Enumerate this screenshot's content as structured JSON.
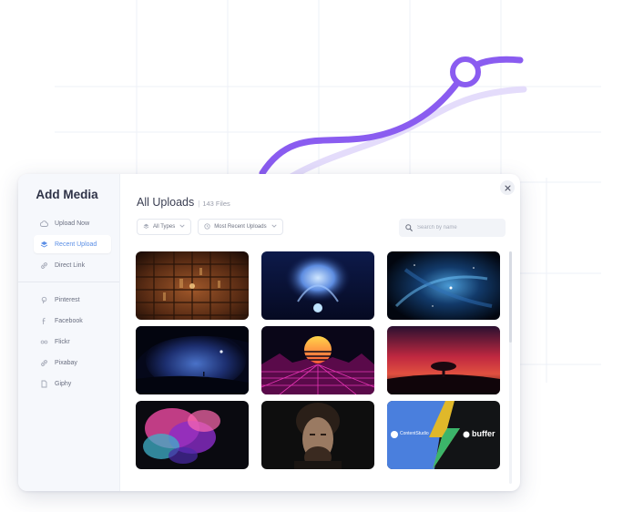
{
  "app": {
    "title": "Add Media",
    "close_icon": "close-icon"
  },
  "sidebar": {
    "items": [
      {
        "label": "Upload Now",
        "icon": "cloud-upload-icon",
        "active": false
      },
      {
        "label": "Recent Upload",
        "icon": "stack-icon",
        "active": true
      },
      {
        "label": "Direct Link",
        "icon": "link-icon",
        "active": false
      }
    ],
    "sources": [
      {
        "label": "Pinterest",
        "icon": "pinterest-icon"
      },
      {
        "label": "Facebook",
        "icon": "facebook-icon"
      },
      {
        "label": "Flickr",
        "icon": "flickr-icon"
      },
      {
        "label": "Pixabay",
        "icon": "pixabay-icon"
      },
      {
        "label": "Giphy",
        "icon": "giphy-icon"
      }
    ]
  },
  "main": {
    "title": "All Uploads",
    "separator": "|",
    "count": "143 Files",
    "filters": {
      "type": "All Types",
      "sort": "Most Recent Uploads"
    },
    "search": {
      "placeholder": "Search by name",
      "value": ""
    },
    "thumbnails": [
      {
        "name": "library-bookshelves"
      },
      {
        "name": "blue-ice-spirit"
      },
      {
        "name": "cosmic-nebula"
      },
      {
        "name": "night-cave"
      },
      {
        "name": "synthwave-sunset"
      },
      {
        "name": "red-sky-tree"
      },
      {
        "name": "pink-smoke"
      },
      {
        "name": "bearded-man-portrait"
      },
      {
        "name": "contentstudio-buffer",
        "left_text": "ContentStudio",
        "right_text": "buffer"
      }
    ]
  },
  "colors": {
    "accent": "#5a8ee6",
    "decor_curve": "#8a5cf0",
    "decor_curve_light": "#e4dcfb"
  }
}
